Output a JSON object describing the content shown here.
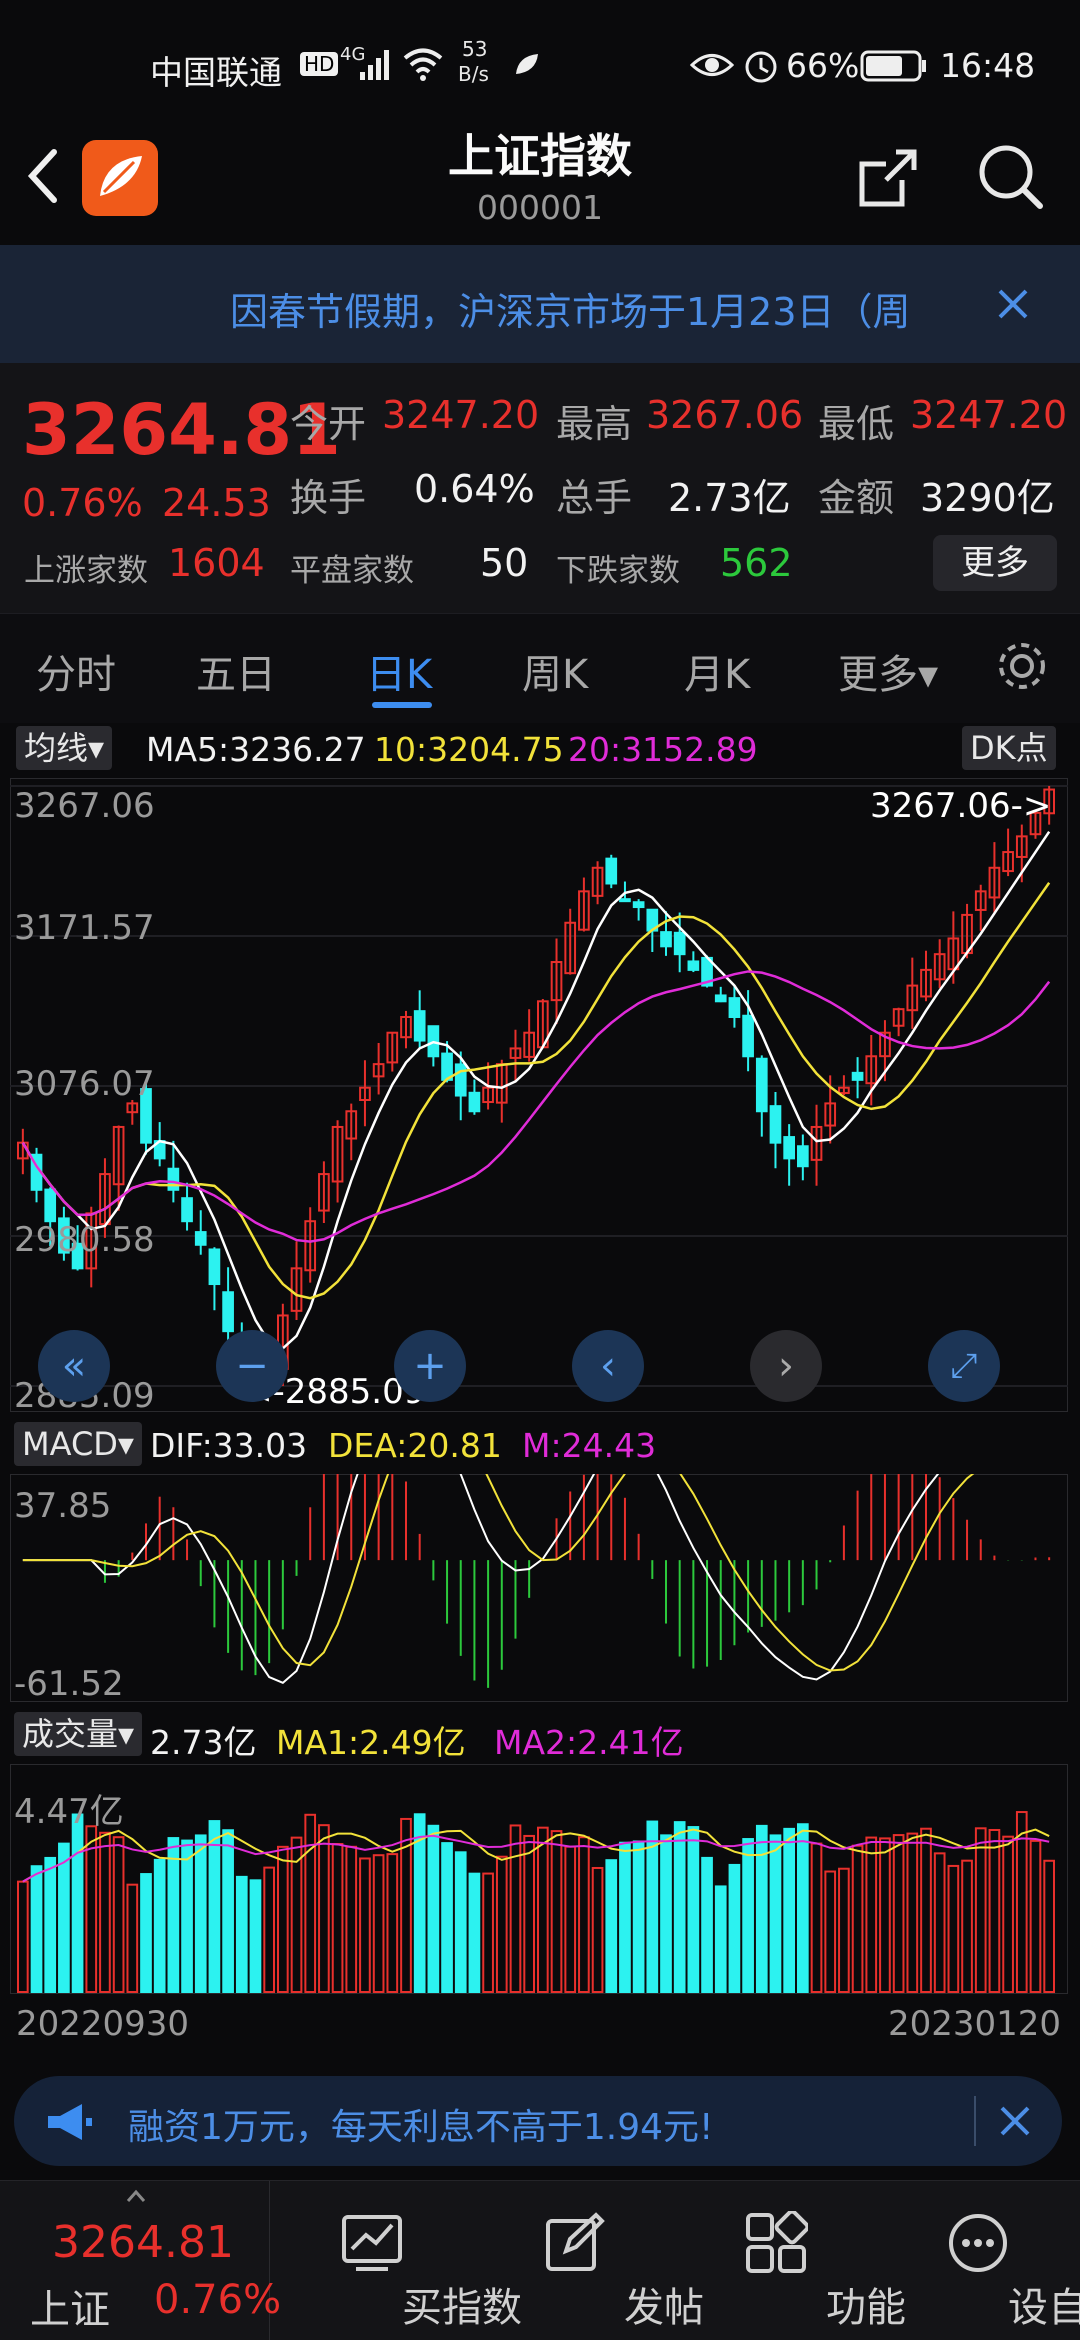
{
  "status_bar": {
    "carrier": "中国联通",
    "hd": "HD",
    "net_speed_value": "53",
    "net_speed_unit": "B/s",
    "network": "4G",
    "battery": "66%",
    "time": "16:48"
  },
  "header": {
    "title": "上证指数",
    "code": "000001"
  },
  "banner": {
    "text": "因春节假期，沪深京市场于1月23日（周"
  },
  "quote": {
    "price": "3264.81",
    "change_pct": "0.76%",
    "change_abs": "24.53",
    "open_label": "今开",
    "open": "3247.20",
    "high_label": "最高",
    "high": "3267.06",
    "low_label": "最低",
    "low": "3247.20",
    "turnover_label": "换手",
    "turnover": "0.64%",
    "volume_label": "总手",
    "volume": "2.73亿",
    "amount_label": "金额",
    "amount": "3290亿",
    "up_label": "上涨家数",
    "up": "1604",
    "flat_label": "平盘家数",
    "flat": "50",
    "down_label": "下跌家数",
    "down": "562",
    "more": "更多"
  },
  "tabs": [
    {
      "label": "分时"
    },
    {
      "label": "五日"
    },
    {
      "label": "日K"
    },
    {
      "label": "周K"
    },
    {
      "label": "月K"
    },
    {
      "label": "更多▾"
    }
  ],
  "kline": {
    "indicator": "均线▾",
    "ma5": "MA5:3236.27",
    "ma10": "10:3204.75",
    "ma20": "20:3152.89",
    "dk": "DK点",
    "y_ticks": [
      "3267.06",
      "3171.57",
      "3076.07",
      "2980.58",
      "2885.09"
    ],
    "max_marker": "3267.06->",
    "min_marker": "<-2885.09"
  },
  "macd": {
    "indicator": "MACD▾",
    "dif": "DIF:33.03",
    "dea": "DEA:20.81",
    "m": "M:24.43",
    "y_ticks": [
      "37.85",
      "-61.52"
    ]
  },
  "vol": {
    "indicator": "成交量▾",
    "value": "2.73亿",
    "ma1": "MA1:2.49亿",
    "ma2": "MA2:2.41亿",
    "y_tick": "4.47亿",
    "date_start": "20220930",
    "date_end": "20230120"
  },
  "ad": {
    "text": "融资1万元，每天利息不高于1.94元!"
  },
  "bottom_nav": {
    "index_price": "3264.81",
    "index_name": "上证",
    "index_change": "0.76%",
    "items": [
      {
        "label": "买指数"
      },
      {
        "label": "发帖"
      },
      {
        "label": "功能"
      },
      {
        "label": "设自选"
      }
    ]
  },
  "colors": {
    "up": "#e8302c",
    "down": "#2cf2f0",
    "ma5": "#ffffff",
    "ma10": "#f2e23a",
    "ma20": "#e02cd8",
    "accent": "#3d8df0"
  },
  "chart_data": {
    "type": "candlestick",
    "x_start": "20220930",
    "x_end": "20230120",
    "ylim": [
      2885.09,
      3267.06
    ],
    "last": {
      "open": 3247.2,
      "high": 3267.06,
      "low": 3247.2,
      "close": 3264.81
    },
    "ma": {
      "MA5": 3236.27,
      "MA10": 3204.75,
      "MA20": 3152.89
    },
    "series": [
      {
        "name": "MA5",
        "color": "#ffffff"
      },
      {
        "name": "MA10",
        "color": "#f2e23a"
      },
      {
        "name": "MA20",
        "color": "#e02cd8"
      }
    ],
    "macd": {
      "DIF": 33.03,
      "DEA": 20.81,
      "M": 24.43,
      "ylim": [
        -61.52,
        37.85
      ]
    },
    "volume": {
      "last": "2.73亿",
      "MA1": "2.49亿",
      "MA2": "2.41亿",
      "ymax": "4.47亿"
    }
  }
}
